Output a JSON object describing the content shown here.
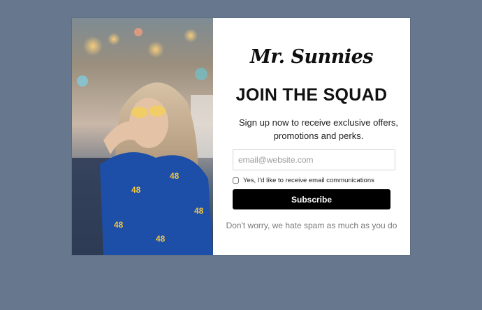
{
  "brand": {
    "logo_text": "Mr. Sunnies"
  },
  "popup": {
    "headline": "JOIN THE SQUAD",
    "subtext": "Sign up now to receive exclusive offers, promotions and perks.",
    "email_placeholder": "email@website.com",
    "consent_label": "Yes, I'd like to receive email communications",
    "consent_checked": false,
    "subscribe_label": "Subscribe",
    "footer_note": "Don't worry, we hate spam as much as you do"
  },
  "colors": {
    "page_background": "#66778e",
    "modal_background": "#ffffff",
    "button_background": "#000000",
    "button_text": "#ffffff"
  },
  "image": {
    "description_icon": "photo-of-woman-with-sunglasses"
  }
}
